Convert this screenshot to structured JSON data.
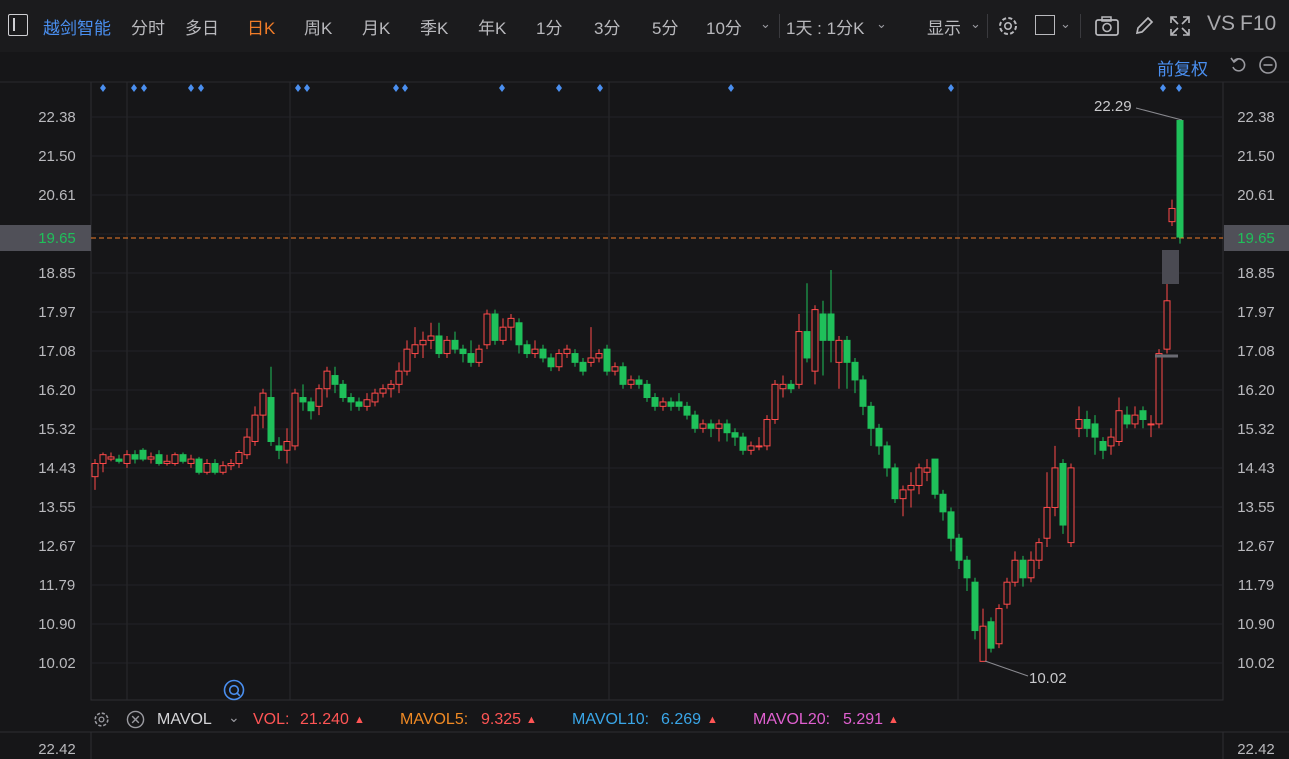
{
  "toolbar": {
    "stock_name": "越剑智能",
    "periods": [
      "分时",
      "多日",
      "日K",
      "周K",
      "月K",
      "季K",
      "年K",
      "1分",
      "3分",
      "5分",
      "10分"
    ],
    "active_period": "日K",
    "multi_period": "1天 : 1分K",
    "display_label": "显示",
    "vs_label": "VS",
    "f10_label": "F10"
  },
  "chart": {
    "adjust_label": "前复权",
    "y_ticks": [
      "22.38",
      "21.50",
      "20.61",
      "19.65",
      "18.85",
      "17.97",
      "17.08",
      "16.20",
      "15.32",
      "14.43",
      "13.55",
      "12.67",
      "11.79",
      "10.90",
      "10.02"
    ],
    "current_price": "19.65",
    "high_label": "22.29",
    "low_label": "10.02",
    "volume_top_tick": "22.42",
    "colors": {
      "up": "#ff4a4a",
      "down": "#1fc05a",
      "accent": "#f07c28",
      "link": "#4a8ff0"
    }
  },
  "indicators": {
    "name": "MAVOL",
    "vol_label": "VOL:",
    "vol_value": "21.240",
    "mavol5_label": "MAVOL5:",
    "mavol5_value": "9.325",
    "mavol10_label": "MAVOL10:",
    "mavol10_value": "6.269",
    "mavol20_label": "MAVOL20:",
    "mavol20_value": "5.291"
  }
}
